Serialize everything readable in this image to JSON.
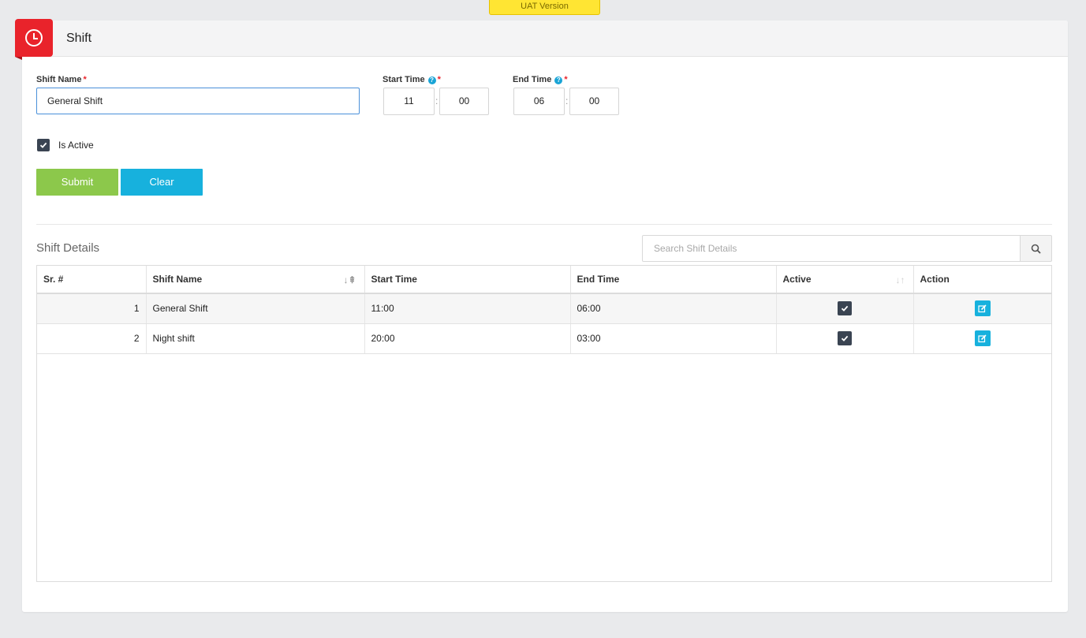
{
  "env_badge": "UAT Version",
  "page": {
    "title": "Shift",
    "icon": "clock-icon"
  },
  "form": {
    "shift_name_label": "Shift Name",
    "shift_name_value": "General Shift",
    "start_time_label": "Start Time",
    "start_hour": "11",
    "start_minute": "00",
    "end_time_label": "End Time",
    "end_hour": "06",
    "end_minute": "00",
    "time_separator": ":",
    "required_mark": "*",
    "help_glyph": "?",
    "is_active_label": "Is Active",
    "is_active": true,
    "submit_label": "Submit",
    "clear_label": "Clear"
  },
  "details": {
    "title": "Shift Details",
    "search_placeholder": "Search Shift Details",
    "columns": [
      "Sr. #",
      "Shift Name",
      "Start Time",
      "End Time",
      "Active",
      "Action"
    ],
    "rows": [
      {
        "sr": "1",
        "name": "General Shift",
        "start": "11:00",
        "end": "06:00",
        "active": true
      },
      {
        "sr": "2",
        "name": "Night shift",
        "start": "20:00",
        "end": "03:00",
        "active": true
      }
    ]
  },
  "colors": {
    "brand_red": "#e9232b",
    "submit_green": "#8cc84b",
    "clear_cyan": "#17b1dd",
    "uat_yellow": "#ffe533"
  }
}
